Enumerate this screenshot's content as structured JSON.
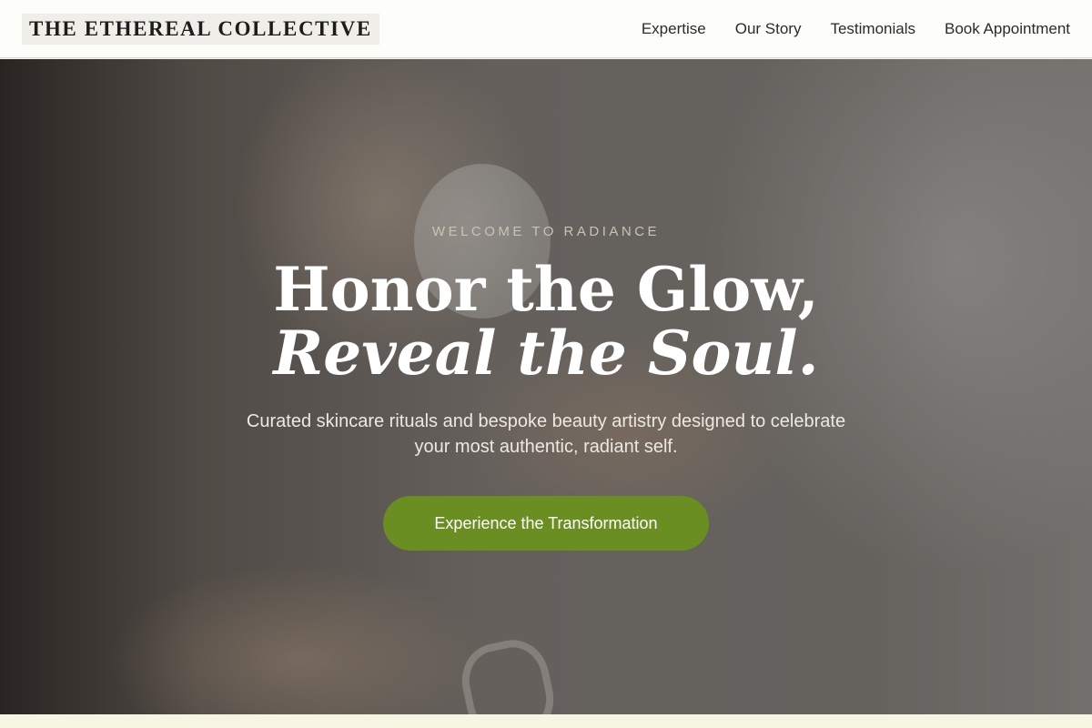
{
  "header": {
    "logo": "THE ETHEREAL COLLECTIVE",
    "nav": [
      "Expertise",
      "Our Story",
      "Testimonials",
      "Book Appointment"
    ]
  },
  "hero": {
    "eyebrow": "WELCOME TO RADIANCE",
    "headline_line1": "Honor the Glow,",
    "headline_line2": "Reveal the Soul.",
    "subtitle": "Curated skincare rituals and bespoke beauty artistry designed to celebrate your most authentic, radiant self.",
    "cta": "Experience the Transformation"
  },
  "colors": {
    "header_bg": "#fdfdf9",
    "cta_bg": "#6b8e23",
    "eyebrow": "#cbc3b2",
    "page_bg": "#f6f5e4"
  }
}
